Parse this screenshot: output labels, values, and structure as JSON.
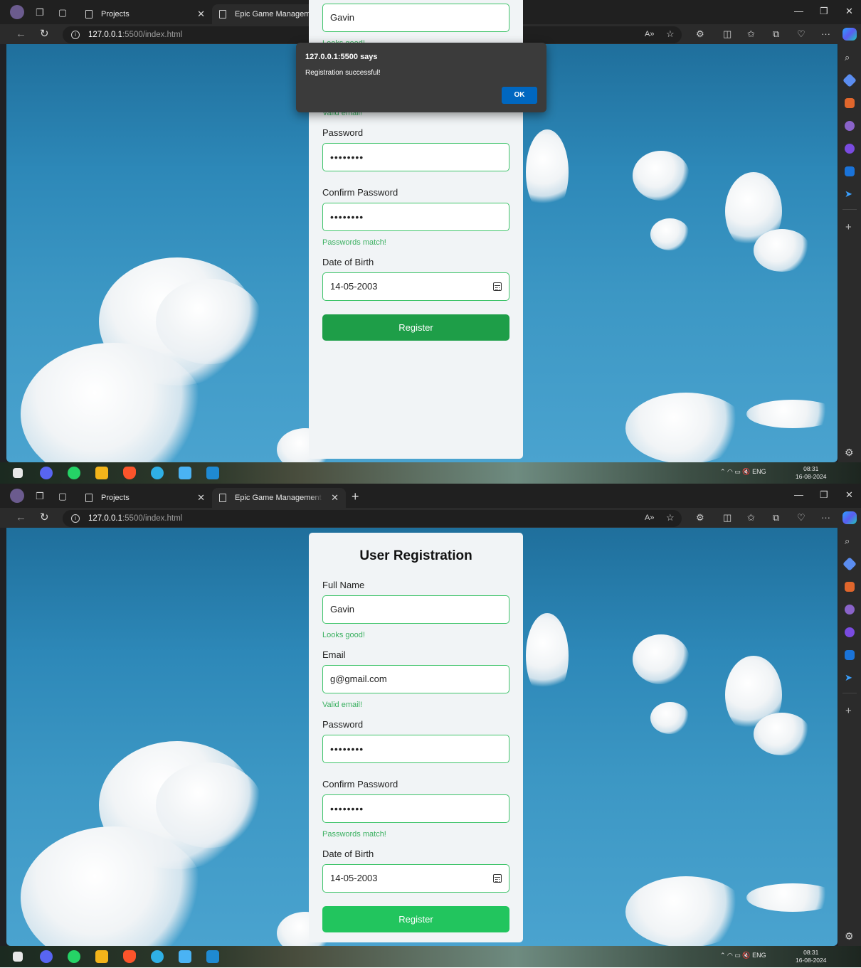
{
  "browser": {
    "tabs": [
      {
        "title": "Projects"
      },
      {
        "title": "Epic Game Management Store - "
      }
    ],
    "url_host": "127.0.0.1",
    "url_path": ":5500/index.html",
    "icons": {
      "back": "back-arrow-icon",
      "reload": "reload-icon",
      "info": "info-icon",
      "read_aloud": "read-aloud-icon",
      "favorite": "star-icon",
      "extensions": "extensions-icon",
      "split": "split-screen-icon",
      "favorites": "favorites-icon",
      "collections": "collections-icon",
      "health": "browser-essentials-icon",
      "more": "more-icon",
      "copilot": "copilot-icon"
    }
  },
  "form": {
    "title": "User Registration",
    "full_name_label": "Full Name",
    "full_name_value": "Gavin",
    "full_name_feedback": "Looks good!",
    "email_label": "Email",
    "email_value": "g@gmail.com",
    "email_feedback": "Valid email!",
    "password_label": "Password",
    "password_value": "••••••••",
    "confirm_label": "Confirm Password",
    "confirm_value": "••••••••",
    "confirm_feedback": "Passwords match!",
    "dob_label": "Date of Birth",
    "dob_value": "14-05-2003",
    "register_label": "Register",
    "colors": {
      "register_pressed": "#1e9e48",
      "register": "#22c55e",
      "valid": "#3ab060"
    }
  },
  "alert": {
    "title": "127.0.0.1:5500 says",
    "message": "Registration successful!",
    "ok_label": "OK"
  },
  "taskbar": {
    "tray_lang": "ENG",
    "clock_time": "08:31",
    "clock_date": "16-08-2024"
  }
}
